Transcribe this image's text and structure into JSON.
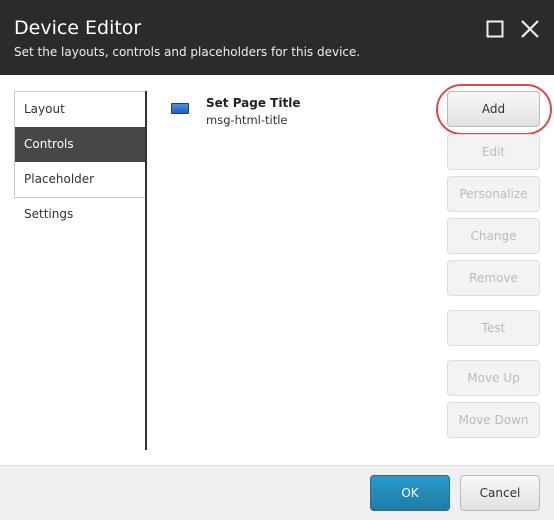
{
  "header": {
    "title": "Device Editor",
    "subtitle": "Set the layouts, controls and placeholders for this device.",
    "maximize_icon": "maximize-icon",
    "close_icon": "close-icon"
  },
  "tabs": [
    {
      "label": "Layout"
    },
    {
      "label": "Controls",
      "selected": true
    },
    {
      "label": "Placeholder Settings"
    }
  ],
  "controls": [
    {
      "name": "Set Page Title",
      "id": "msg-html-title",
      "icon": "rendering-icon"
    }
  ],
  "actions": {
    "add": "Add",
    "edit": "Edit",
    "personalize": "Personalize",
    "change": "Change",
    "remove": "Remove",
    "test": "Test",
    "move_up": "Move Up",
    "move_down": "Move Down"
  },
  "footer": {
    "ok": "OK",
    "cancel": "Cancel"
  },
  "colors": {
    "header": "#2b2b2b",
    "accent": "#2389b8",
    "highlight": "#e04848"
  }
}
